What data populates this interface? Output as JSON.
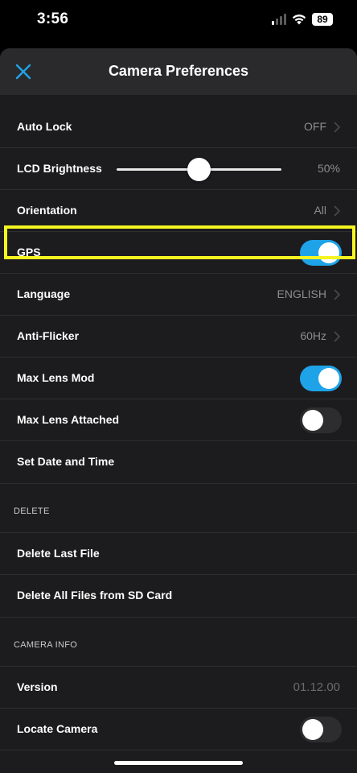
{
  "status": {
    "time": "3:56",
    "battery": "89"
  },
  "header": {
    "title": "Camera Preferences"
  },
  "rows": {
    "auto_lock": {
      "label": "Auto Lock",
      "value": "OFF"
    },
    "lcd_brightness": {
      "label": "LCD Brightness",
      "value": "50%",
      "level": 0.5
    },
    "orientation": {
      "label": "Orientation",
      "value": "All"
    },
    "gps": {
      "label": "GPS",
      "on": true
    },
    "language": {
      "label": "Language",
      "value": "ENGLISH"
    },
    "anti_flicker": {
      "label": "Anti-Flicker",
      "value": "60Hz"
    },
    "max_lens_mod": {
      "label": "Max Lens Mod",
      "on": true
    },
    "max_lens_attached": {
      "label": "Max Lens Attached",
      "on": false
    },
    "set_date_time": {
      "label": "Set Date and Time"
    }
  },
  "delete_section": {
    "header": "DELETE",
    "delete_last": "Delete Last File",
    "delete_all": "Delete All Files from SD Card"
  },
  "camera_info": {
    "header": "CAMERA INFO",
    "version_label": "Version",
    "version_value": "01.12.00",
    "locate_label": "Locate Camera",
    "locate_on": false
  },
  "colors": {
    "accent": "#1fa3e8",
    "highlight": "#f5f522"
  },
  "icons": {
    "close": "close-icon",
    "chevron": "chevron-right-icon"
  }
}
